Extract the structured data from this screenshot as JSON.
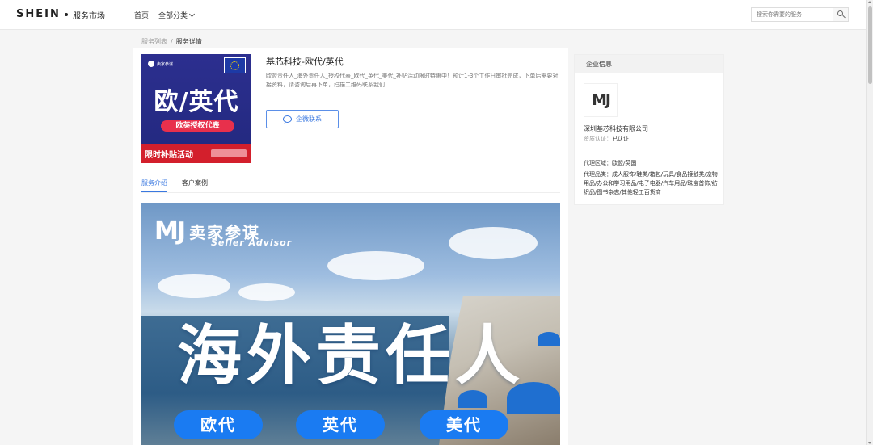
{
  "header": {
    "brand": "SHEIN",
    "brand_sub": "服务市场",
    "nav_home": "首页",
    "nav_categories": "全部分类",
    "search_placeholder": "搜索你需要的服务"
  },
  "breadcrumb": {
    "parent": "服务列表",
    "separator": "/",
    "current": "服务详情"
  },
  "product": {
    "title": "基芯科技-欧代/英代",
    "description": "欧盟责任人_海外责任人_授权代表_欧代_英代_美代_补贴活动限时特惠中！预计1-3个工作日审批完成，下单后需要对接资料，请咨询后再下单，扫描二维码联系我们",
    "contact_button": "企微联系",
    "image": {
      "brand": "卖家参谋",
      "headline": "欧/英代",
      "tag": "欧英授权代表",
      "promo": "限时补贴活动"
    }
  },
  "tabs": [
    {
      "label": "服务介绍",
      "active": true
    },
    {
      "label": "客户案例",
      "active": false
    }
  ],
  "banner": {
    "logo_mark": "MJ",
    "logo_cn": "卖家参谋",
    "logo_en": "Seller Advisor",
    "headline": "海外责任人",
    "pills": [
      "欧代",
      "英代",
      "美代"
    ]
  },
  "company": {
    "panel_title": "企业信息",
    "logo_text": "MJ",
    "name": "深圳基芯科技有限公司",
    "cert_label": "资质认证：",
    "cert_value": "已认证",
    "region": "代理区域：欧盟/英国",
    "categories": "代理品类：成人服饰/鞋类/箱包/玩具/食品接触类/宠物用品/办公和学习用品/电子电器/汽车用品/珠宝首饰/纺织品/图书杂志/其他轻工百货商"
  },
  "colors": {
    "accent": "#3a78e0",
    "banner_pill": "#1a7bf2",
    "promo_red": "#d31f2c",
    "product_bg": "#2c2f8f"
  }
}
